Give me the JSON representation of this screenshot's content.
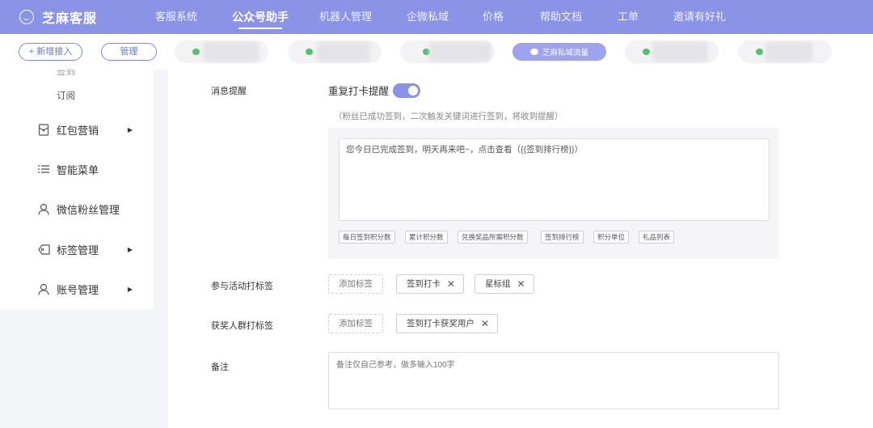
{
  "brand": {
    "name": "芝麻客服",
    "logo_icon": "smile-logo-icon"
  },
  "nav": {
    "items": [
      {
        "label": "客服系统"
      },
      {
        "label": "公众号助手",
        "active": true
      },
      {
        "label": "机器人管理"
      },
      {
        "label": "企微私域"
      },
      {
        "label": "价格"
      },
      {
        "label": "帮助文档"
      },
      {
        "label": "工单"
      },
      {
        "label": "邀请有好礼"
      }
    ]
  },
  "strip": {
    "add_label": "+ 新增接入",
    "manage_label": "管理",
    "active_account": "芝麻私域流量"
  },
  "sidebar": {
    "partial_label": "签到",
    "sub_subscribe": "订阅",
    "items": [
      {
        "label": "红包营销",
        "icon": "red-packet-icon",
        "has_arrow": true
      },
      {
        "label": "智能菜单",
        "icon": "menu-list-icon",
        "has_arrow": false
      },
      {
        "label": "微信粉丝管理",
        "icon": "user-icon",
        "has_arrow": false
      },
      {
        "label": "标签管理",
        "icon": "tag-icon",
        "has_arrow": true
      },
      {
        "label": "账号管理",
        "icon": "user-icon",
        "has_arrow": true
      }
    ]
  },
  "form": {
    "reminder_label": "消息提醒",
    "repeat_reminder_label": "重复打卡提醒",
    "repeat_reminder_on": true,
    "hint": "（粉丝已成功签到，二次触发关键词进行签到，将收到提醒）",
    "message": "您今日已完成签到，明天再来吧~，点击查看（{{签到排行榜}}）",
    "variables": [
      "每日签到积分数",
      "累计积分数",
      "兑换奖品所需积分数",
      "签到排行榜",
      "积分单位",
      "礼品列表"
    ],
    "activity_tag_label": "参与活动打标签",
    "add_tag_label": "添加标签",
    "activity_tags": [
      "签到打卡",
      "星标组"
    ],
    "winner_tag_label": "获奖人群打标签",
    "winner_tags": [
      "签到打卡获奖用户"
    ],
    "remark_label": "备注",
    "remark_placeholder": "备注仅自己参考，做多输入100字"
  },
  "colors": {
    "primary": "#8b93e6",
    "wechat_green": "#52c26b"
  }
}
